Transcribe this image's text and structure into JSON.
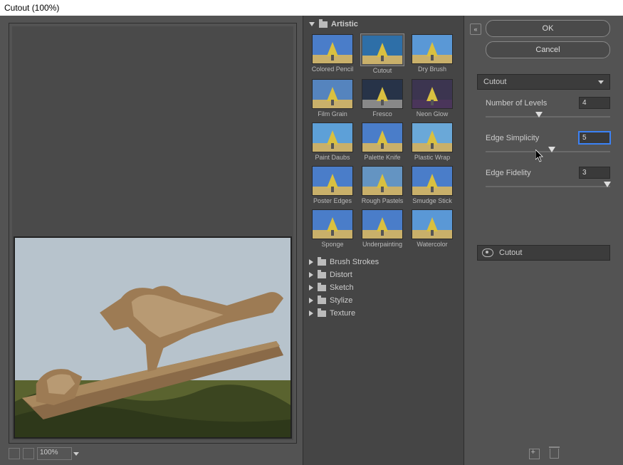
{
  "window": {
    "title": "Cutout (100%)"
  },
  "zoom": {
    "value": "100%"
  },
  "category_open": {
    "name": "Artistic"
  },
  "filters": [
    "Colored Pencil",
    "Cutout",
    "Dry Brush",
    "Film Grain",
    "Fresco",
    "Neon Glow",
    "Paint Daubs",
    "Palette Knife",
    "Plastic Wrap",
    "Poster Edges",
    "Rough Pastels",
    "Smudge Stick",
    "Sponge",
    "Underpainting",
    "Watercolor"
  ],
  "filters_selected": "Cutout",
  "categories": [
    "Brush Strokes",
    "Distort",
    "Sketch",
    "Stylize",
    "Texture"
  ],
  "buttons": {
    "ok": "OK",
    "cancel": "Cancel"
  },
  "current_filter": {
    "name": "Cutout"
  },
  "params": {
    "levels": {
      "label": "Number of Levels",
      "value": "4",
      "pos": 40
    },
    "simplicity": {
      "label": "Edge Simplicity",
      "value": "5",
      "pos": 50
    },
    "fidelity": {
      "label": "Edge Fidelity",
      "value": "3",
      "pos": 95
    }
  },
  "layer": {
    "name": "Cutout"
  }
}
